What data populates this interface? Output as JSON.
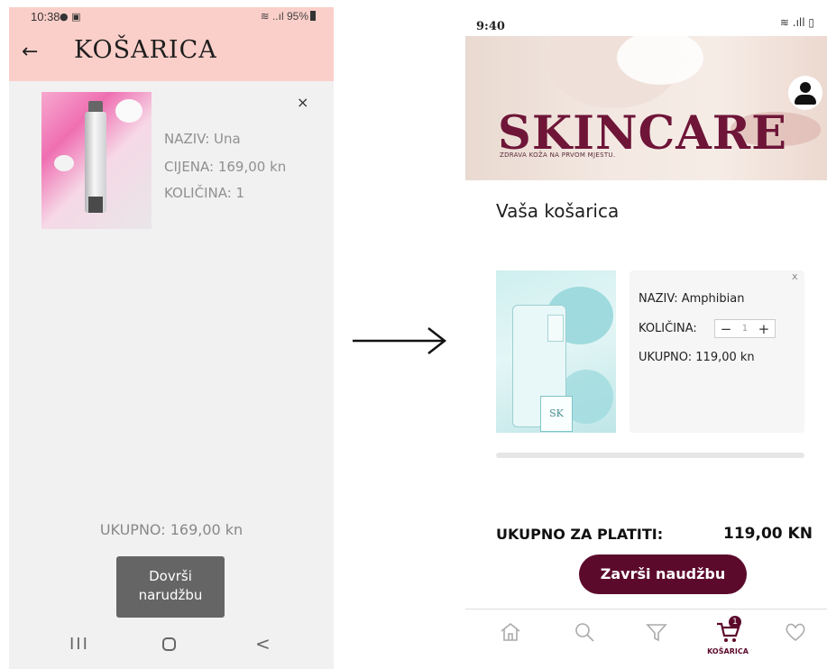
{
  "left_phone": {
    "status": {
      "time": "10:38",
      "icons": "● ▣",
      "battery": "95%"
    },
    "header": {
      "title": "KOŠARICA"
    },
    "product": {
      "name": "NAZIV: Una",
      "price": "CIJENA: 169,00 kn",
      "quantity": "KOLIČINA: 1",
      "close": "×"
    },
    "total": "UKUPNO: 169,00 kn",
    "finish_button": "Dovrši narudžbu",
    "navbar": {
      "recents": "III",
      "back": "<"
    }
  },
  "arrow": "right-arrow",
  "right_phone": {
    "status": {
      "time": "9:40"
    },
    "banner": {
      "title": "SKINCARE",
      "tagline": "ZDRAVA KOŽA NA PRVOM MJESTU."
    },
    "heading": "Vaša košarica",
    "product": {
      "name": "NAZIV: Amphibian",
      "quantity_label": "KOLIČINA:",
      "quantity": "1",
      "minus": "−",
      "plus": "+",
      "subtotal": "UKUPNO: 119,00 kn",
      "close": "x",
      "label_mark": "SK"
    },
    "total_label": "UKUPNO ZA PLATITI:",
    "total_value": "119,00 KN",
    "finish_button": "Završi naudžbu",
    "bottom_nav": {
      "cart_badge": "1",
      "cart_label": "KOŠARICA"
    },
    "colors": {
      "accent": "#5c0a2c",
      "brand": "#6e1538"
    }
  }
}
